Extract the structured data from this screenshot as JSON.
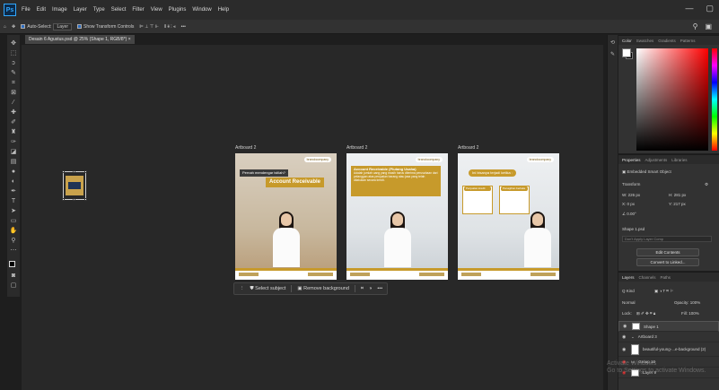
{
  "app": {
    "logo": "Ps"
  },
  "menu": [
    "File",
    "Edit",
    "Image",
    "Layer",
    "Type",
    "Select",
    "Filter",
    "View",
    "Plugins",
    "Window",
    "Help"
  ],
  "window_controls": [
    "—",
    "▢"
  ],
  "options_bar": {
    "auto_select_label": "Auto-Select:",
    "auto_select_value": "Layer",
    "transform_label": "Show Transform Controls",
    "more": "•••"
  },
  "document_tab": "Desain 6 Agustus.psd @ 25% (Shape 1, RGB/8*) ×",
  "artboards": [
    {
      "label": "Artboard 2",
      "brand": "brand•company",
      "line1": "Pernah mendengar istilah?",
      "line2": "Account Receivable"
    },
    {
      "label": "Artboard 2",
      "brand": "brand•company",
      "heading": "Account Receivable (Piutang Usaha)",
      "body": "Adalah jumlah uang yang masih harus diterima perusahaan dari pelanggan atas penjualan barang atau jasa yang telah dilakukan secara kredit."
    },
    {
      "label": "Artboard 2",
      "brand": "brand•company",
      "heading": "Ini bisanya terjadi ketika :",
      "card1": "Penjualan kredit",
      "card2": "Penagihan berkala"
    }
  ],
  "context_bar": {
    "select_subject": "Select subject",
    "remove_background": "Remove background",
    "more": "•••"
  },
  "color_panel": {
    "tabs": [
      "Color",
      "Swatches",
      "Gradients",
      "Patterns"
    ]
  },
  "properties_panel": {
    "tabs": [
      "Properties",
      "Adjustments",
      "Libraries"
    ],
    "type": "Embedded Smart Object",
    "section": "Transform",
    "w": "W:  226 px",
    "h": "H:  281 px",
    "x": "X:  0 px",
    "y": "Y:  217 px",
    "angle": "0.00°",
    "layer_comp_label": "Shape 1.psd",
    "placeholder": "Don't Apply Layer Comp",
    "edit_contents": "Edit Contents",
    "convert": "Convert to Linked..."
  },
  "layers_panel": {
    "tabs": [
      "Layers",
      "Channels",
      "Paths"
    ],
    "kind": "Q Kind",
    "blend": "Normal",
    "opacity": "Opacity: 100%",
    "lock": "Lock:",
    "fill": "Fill: 100%",
    "rows": [
      "Shape 1",
      "Artboard 3",
      "beautiful-young-...e-background (2)",
      "Group 10",
      "Layer 9"
    ]
  },
  "watermark": {
    "line1": "Activate Windows",
    "line2": "Go to Settings to activate Windows."
  }
}
